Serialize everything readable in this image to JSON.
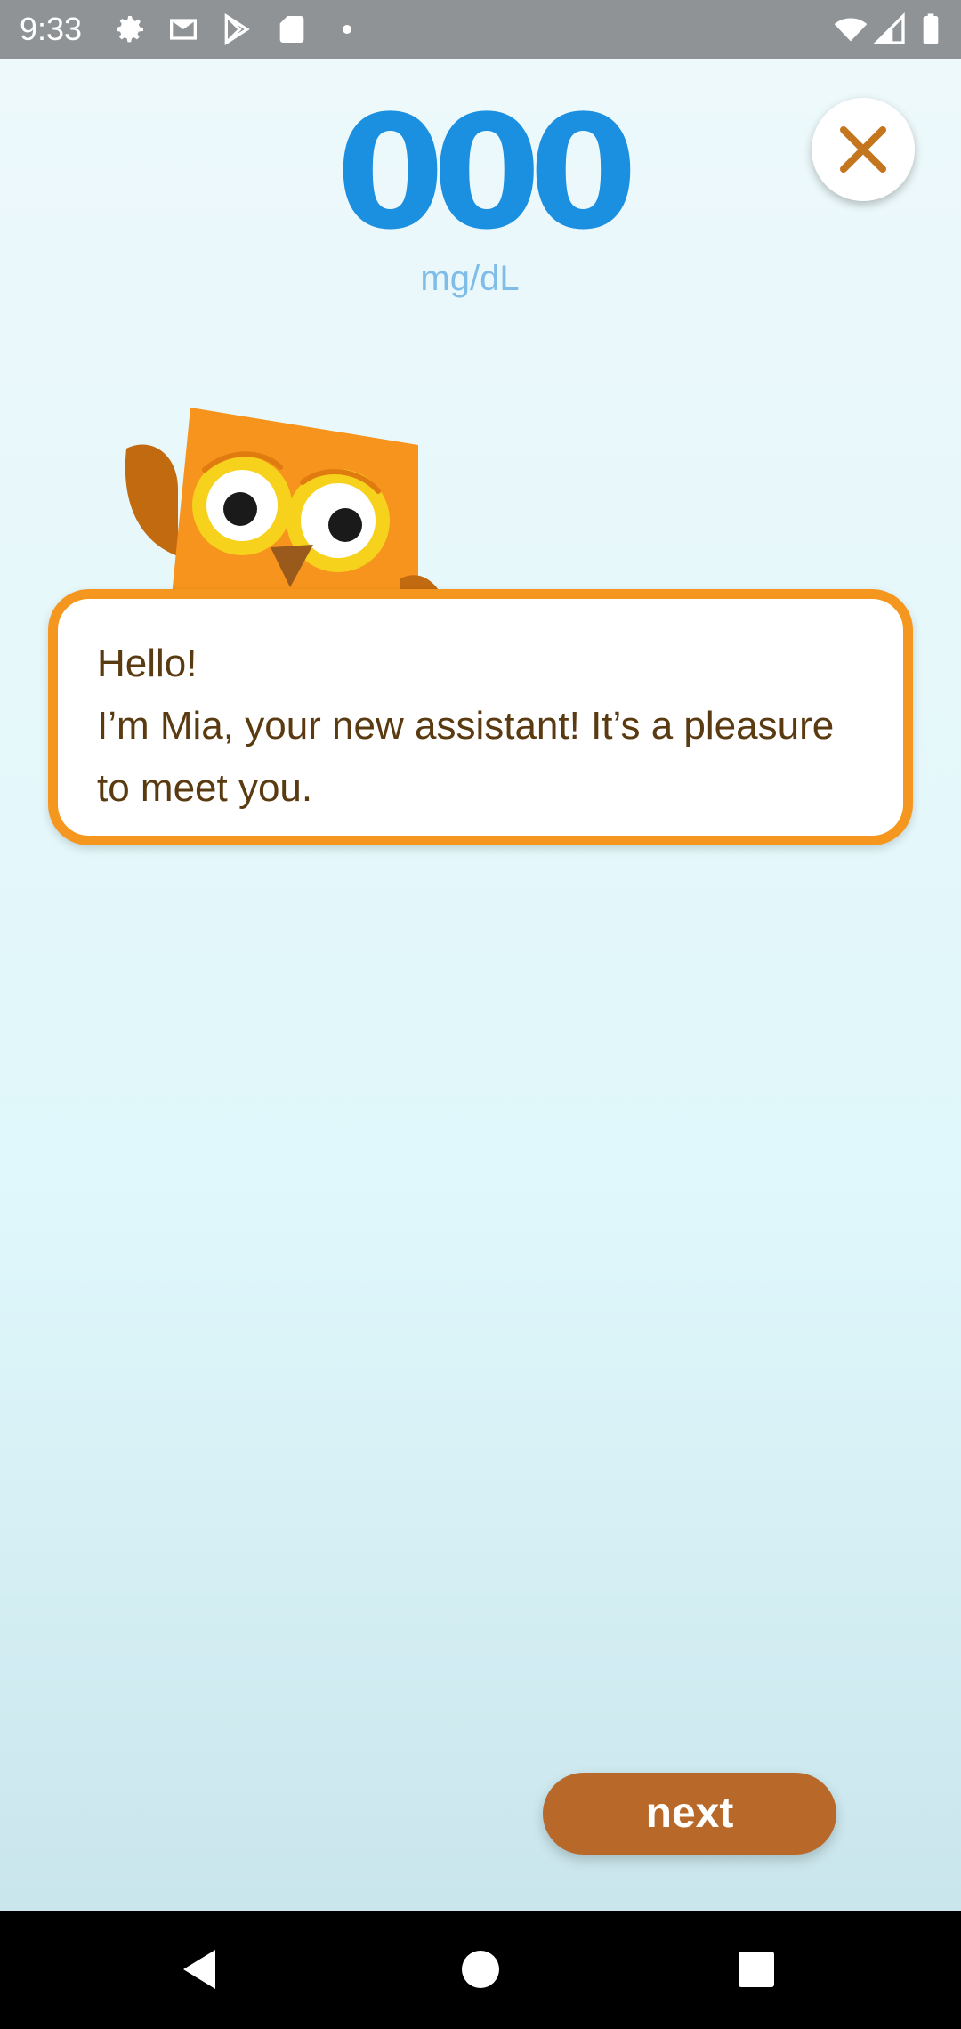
{
  "status_bar": {
    "time": "9:33",
    "icons": [
      "gear-icon",
      "gmail-icon",
      "play-store-icon",
      "sd-card-icon",
      "dot-icon",
      "wifi-icon",
      "signal-icon",
      "battery-icon"
    ]
  },
  "glucose": {
    "value": "000",
    "unit": "mg/dL",
    "color": "#1b8fe0"
  },
  "close_button": {
    "icon": "close-icon",
    "color": "#c4761f"
  },
  "assistant": {
    "icon": "owl-mascot-icon",
    "lines": [
      "Hello!",
      "I’m Mia, your new assistant! It’s a pleasure",
      "to meet you."
    ]
  },
  "next_button": {
    "label": "next",
    "color": "#b8692a"
  },
  "nav_bar": {
    "icons": [
      "back-icon",
      "home-icon",
      "recents-icon"
    ]
  },
  "colors": {
    "bubble_border": "#f5961e",
    "bubble_text": "#5a3a10"
  }
}
